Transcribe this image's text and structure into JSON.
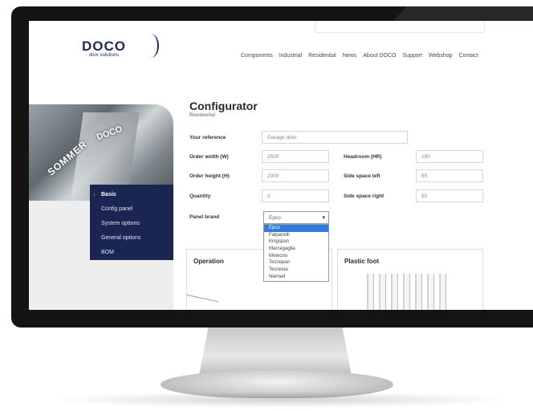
{
  "brand": {
    "name": "DOCO",
    "tagline": "door solutions"
  },
  "nav": [
    "Components",
    "Industrial",
    "Residential",
    "News",
    "About DOCO",
    "Support",
    "Webshop",
    "Contact"
  ],
  "hero": {
    "text1": "SOMMER",
    "text2": "DOCO"
  },
  "sidebar": [
    {
      "label": "Basis",
      "active": true
    },
    {
      "label": "Config panel"
    },
    {
      "label": "System options"
    },
    {
      "label": "General options"
    },
    {
      "label": "BOM"
    }
  ],
  "page": {
    "title": "Configurator",
    "subtitle": "Residential"
  },
  "form": {
    "reference_label": "Your reference",
    "reference_value": "Garage door",
    "order_width_label": "Order width (W)",
    "order_width_value": "2500",
    "order_height_label": "Order height (H)",
    "order_height_value": "2000",
    "quantity_label": "Quantity",
    "quantity_value": "2",
    "headroom_label": "Headroom (HR)",
    "headroom_value": "190",
    "side_left_label": "Side space left",
    "side_left_value": "85",
    "side_right_label": "Side space right",
    "side_right_value": "85",
    "panel_brand_label": "Panel brand",
    "panel_brand_value": "Epco",
    "panel_brand_options": [
      "Epco",
      "Falpanelli",
      "Kingspan",
      "Marcegaglia",
      "Metecno",
      "Tecnopan",
      "Tecnesia",
      "Niemelt"
    ]
  },
  "cards": {
    "operation": "Operation",
    "plastic_foot": "Plastic foot"
  }
}
